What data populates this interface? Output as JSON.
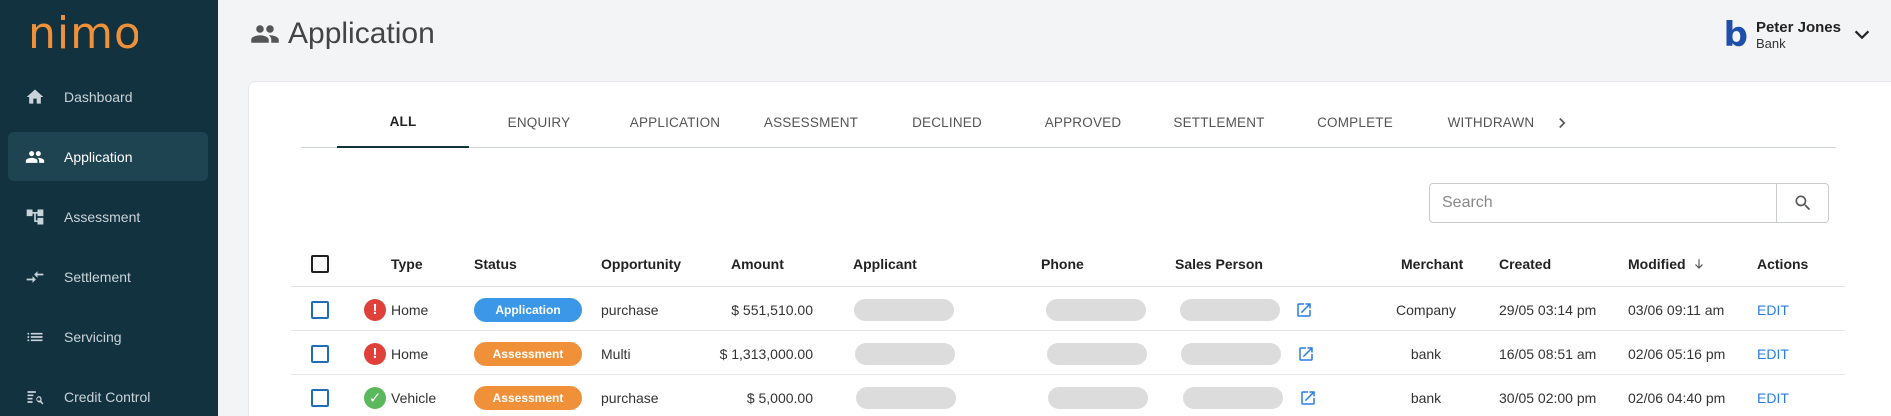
{
  "app": {
    "logo_text": "nimo"
  },
  "sidebar": {
    "items": [
      {
        "label": "Dashboard",
        "icon": "home-icon"
      },
      {
        "label": "Application",
        "icon": "people-icon",
        "active": true
      },
      {
        "label": "Assessment",
        "icon": "tree-icon"
      },
      {
        "label": "Settlement",
        "icon": "arrows-icon"
      },
      {
        "label": "Servicing",
        "icon": "list-icon"
      },
      {
        "label": "Credit Control",
        "icon": "search-list-icon"
      }
    ]
  },
  "header": {
    "title": "Application"
  },
  "user": {
    "logo_letter": "b",
    "name": "Peter Jones",
    "org": "Bank"
  },
  "tabs": [
    "ALL",
    "ENQUIRY",
    "APPLICATION",
    "ASSESSMENT",
    "DECLINED",
    "APPROVED",
    "SETTLEMENT",
    "COMPLETE",
    "WITHDRAWN"
  ],
  "search": {
    "placeholder": "Search",
    "value": ""
  },
  "table": {
    "headers": {
      "type": "Type",
      "status": "Status",
      "opportunity": "Opportunity",
      "amount": "Amount",
      "applicant": "Applicant",
      "phone": "Phone",
      "sales_person": "Sales Person",
      "merchant": "Merchant",
      "created": "Created",
      "modified": "Modified",
      "actions": "Actions"
    },
    "rows": [
      {
        "alert": "error",
        "type": "Home",
        "status": "Application",
        "status_color": "#3b97e8",
        "opportunity": "purchase",
        "amount": "$ 551,510.00",
        "merchant": "Company",
        "created": "29/05 03:14 pm",
        "modified": "03/06 09:11 am",
        "action": "EDIT"
      },
      {
        "alert": "error",
        "type": "Home",
        "status": "Assessment",
        "status_color": "#f0913a",
        "opportunity": "Multi",
        "amount": "$ 1,313,000.00",
        "merchant": "bank",
        "created": "16/05 08:51 am",
        "modified": "02/06 05:16 pm",
        "action": "EDIT"
      },
      {
        "alert": "ok",
        "type": "Vehicle",
        "status": "Assessment",
        "status_color": "#f0913a",
        "opportunity": "purchase",
        "amount": "$ 5,000.00",
        "merchant": "bank",
        "created": "30/05 02:00 pm",
        "modified": "02/06 04:40 pm",
        "action": "EDIT"
      }
    ]
  },
  "colors": {
    "sidebar_bg": "#13323f",
    "accent": "#f0913a",
    "link": "#2a7de1",
    "error": "#e0403a",
    "ok": "#5cb85c"
  }
}
